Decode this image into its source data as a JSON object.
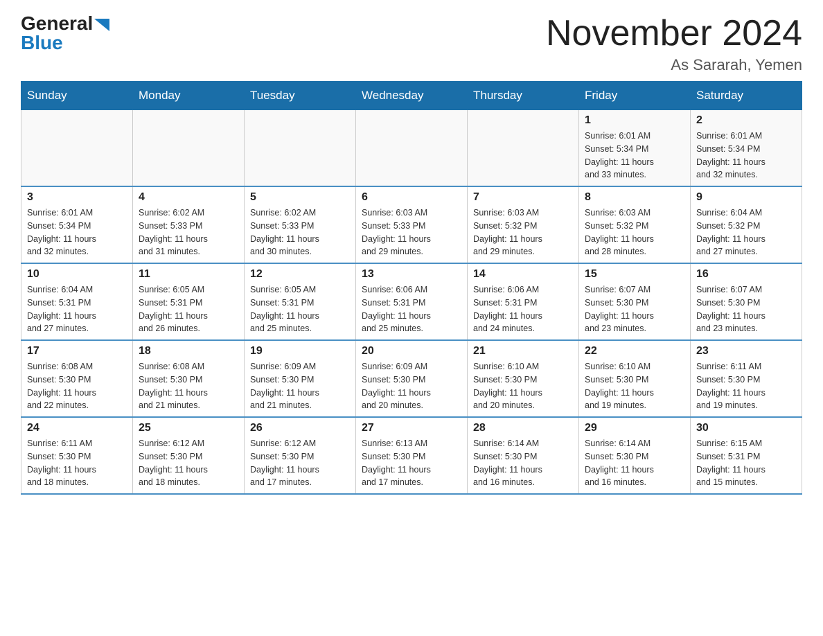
{
  "header": {
    "logo_general": "General",
    "logo_blue": "Blue",
    "month_year": "November 2024",
    "location": "As Sararah, Yemen"
  },
  "weekdays": [
    "Sunday",
    "Monday",
    "Tuesday",
    "Wednesday",
    "Thursday",
    "Friday",
    "Saturday"
  ],
  "weeks": [
    [
      {
        "day": "",
        "info": ""
      },
      {
        "day": "",
        "info": ""
      },
      {
        "day": "",
        "info": ""
      },
      {
        "day": "",
        "info": ""
      },
      {
        "day": "",
        "info": ""
      },
      {
        "day": "1",
        "info": "Sunrise: 6:01 AM\nSunset: 5:34 PM\nDaylight: 11 hours\nand 33 minutes."
      },
      {
        "day": "2",
        "info": "Sunrise: 6:01 AM\nSunset: 5:34 PM\nDaylight: 11 hours\nand 32 minutes."
      }
    ],
    [
      {
        "day": "3",
        "info": "Sunrise: 6:01 AM\nSunset: 5:34 PM\nDaylight: 11 hours\nand 32 minutes."
      },
      {
        "day": "4",
        "info": "Sunrise: 6:02 AM\nSunset: 5:33 PM\nDaylight: 11 hours\nand 31 minutes."
      },
      {
        "day": "5",
        "info": "Sunrise: 6:02 AM\nSunset: 5:33 PM\nDaylight: 11 hours\nand 30 minutes."
      },
      {
        "day": "6",
        "info": "Sunrise: 6:03 AM\nSunset: 5:33 PM\nDaylight: 11 hours\nand 29 minutes."
      },
      {
        "day": "7",
        "info": "Sunrise: 6:03 AM\nSunset: 5:32 PM\nDaylight: 11 hours\nand 29 minutes."
      },
      {
        "day": "8",
        "info": "Sunrise: 6:03 AM\nSunset: 5:32 PM\nDaylight: 11 hours\nand 28 minutes."
      },
      {
        "day": "9",
        "info": "Sunrise: 6:04 AM\nSunset: 5:32 PM\nDaylight: 11 hours\nand 27 minutes."
      }
    ],
    [
      {
        "day": "10",
        "info": "Sunrise: 6:04 AM\nSunset: 5:31 PM\nDaylight: 11 hours\nand 27 minutes."
      },
      {
        "day": "11",
        "info": "Sunrise: 6:05 AM\nSunset: 5:31 PM\nDaylight: 11 hours\nand 26 minutes."
      },
      {
        "day": "12",
        "info": "Sunrise: 6:05 AM\nSunset: 5:31 PM\nDaylight: 11 hours\nand 25 minutes."
      },
      {
        "day": "13",
        "info": "Sunrise: 6:06 AM\nSunset: 5:31 PM\nDaylight: 11 hours\nand 25 minutes."
      },
      {
        "day": "14",
        "info": "Sunrise: 6:06 AM\nSunset: 5:31 PM\nDaylight: 11 hours\nand 24 minutes."
      },
      {
        "day": "15",
        "info": "Sunrise: 6:07 AM\nSunset: 5:30 PM\nDaylight: 11 hours\nand 23 minutes."
      },
      {
        "day": "16",
        "info": "Sunrise: 6:07 AM\nSunset: 5:30 PM\nDaylight: 11 hours\nand 23 minutes."
      }
    ],
    [
      {
        "day": "17",
        "info": "Sunrise: 6:08 AM\nSunset: 5:30 PM\nDaylight: 11 hours\nand 22 minutes."
      },
      {
        "day": "18",
        "info": "Sunrise: 6:08 AM\nSunset: 5:30 PM\nDaylight: 11 hours\nand 21 minutes."
      },
      {
        "day": "19",
        "info": "Sunrise: 6:09 AM\nSunset: 5:30 PM\nDaylight: 11 hours\nand 21 minutes."
      },
      {
        "day": "20",
        "info": "Sunrise: 6:09 AM\nSunset: 5:30 PM\nDaylight: 11 hours\nand 20 minutes."
      },
      {
        "day": "21",
        "info": "Sunrise: 6:10 AM\nSunset: 5:30 PM\nDaylight: 11 hours\nand 20 minutes."
      },
      {
        "day": "22",
        "info": "Sunrise: 6:10 AM\nSunset: 5:30 PM\nDaylight: 11 hours\nand 19 minutes."
      },
      {
        "day": "23",
        "info": "Sunrise: 6:11 AM\nSunset: 5:30 PM\nDaylight: 11 hours\nand 19 minutes."
      }
    ],
    [
      {
        "day": "24",
        "info": "Sunrise: 6:11 AM\nSunset: 5:30 PM\nDaylight: 11 hours\nand 18 minutes."
      },
      {
        "day": "25",
        "info": "Sunrise: 6:12 AM\nSunset: 5:30 PM\nDaylight: 11 hours\nand 18 minutes."
      },
      {
        "day": "26",
        "info": "Sunrise: 6:12 AM\nSunset: 5:30 PM\nDaylight: 11 hours\nand 17 minutes."
      },
      {
        "day": "27",
        "info": "Sunrise: 6:13 AM\nSunset: 5:30 PM\nDaylight: 11 hours\nand 17 minutes."
      },
      {
        "day": "28",
        "info": "Sunrise: 6:14 AM\nSunset: 5:30 PM\nDaylight: 11 hours\nand 16 minutes."
      },
      {
        "day": "29",
        "info": "Sunrise: 6:14 AM\nSunset: 5:30 PM\nDaylight: 11 hours\nand 16 minutes."
      },
      {
        "day": "30",
        "info": "Sunrise: 6:15 AM\nSunset: 5:31 PM\nDaylight: 11 hours\nand 15 minutes."
      }
    ]
  ]
}
